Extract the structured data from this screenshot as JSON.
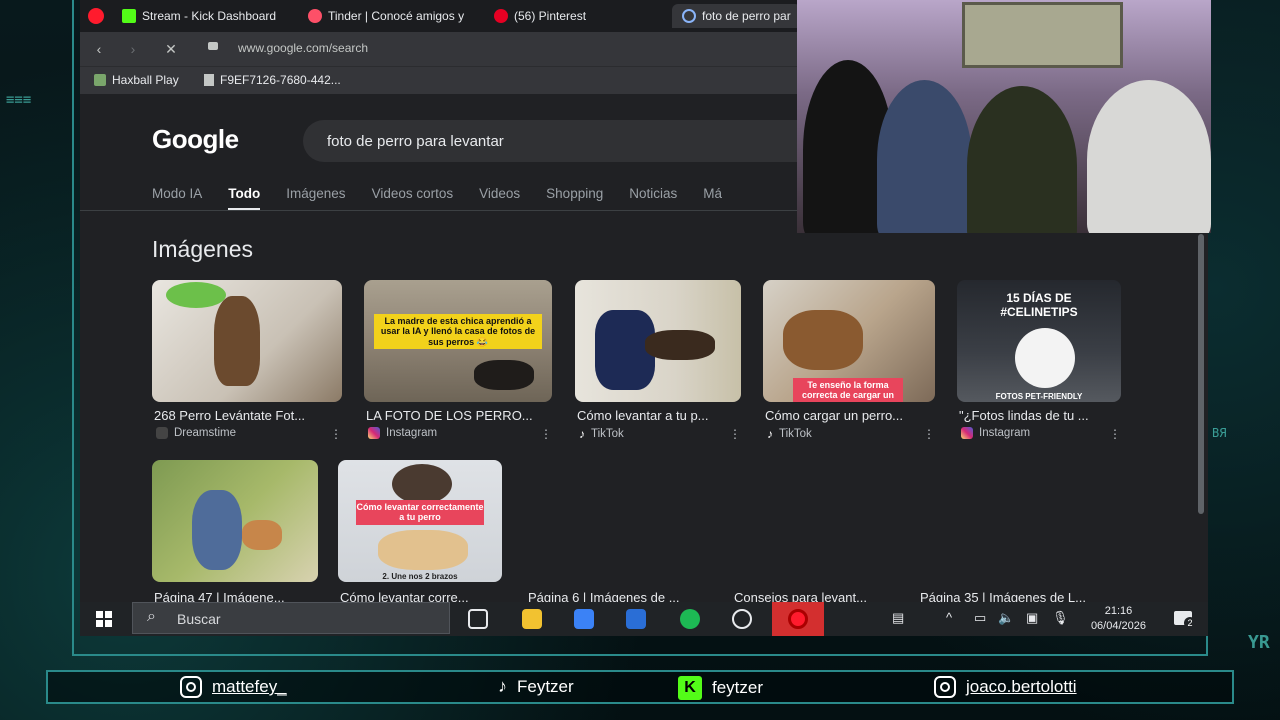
{
  "browser": {
    "tabs": [
      {
        "label": "Stream - Kick Dashboard",
        "color": "#53fc18"
      },
      {
        "label": "Tinder | Conocé amigos y",
        "color": "#fd5068"
      },
      {
        "label": "(56) Pinterest",
        "color": "#e60023"
      },
      {
        "label": "foto de perro par",
        "color": "#8ab4f8"
      }
    ],
    "url": "www.google.com/search",
    "bookmarks": [
      "Haxball Play",
      "F9EF7126-7680-442..."
    ]
  },
  "google": {
    "logo": "Google",
    "query": "foto de perro para levantar",
    "tabs": [
      "Modo IA",
      "Todo",
      "Imágenes",
      "Videos cortos",
      "Videos",
      "Shopping",
      "Noticias",
      "Má"
    ],
    "selected_tab": "Todo",
    "images_heading": "Imágenes",
    "results": [
      {
        "title": "268 Perro Levántate Fot...",
        "source": "Dreamstime",
        "source_color": "#bdc1c6"
      },
      {
        "title": "LA FOTO DE LOS PERRO...",
        "source": "Instagram",
        "source_color": "#d6249f",
        "caption": "La madre de esta chica aprendió a usar la IA y llenó la casa de fotos de sus perros 😂"
      },
      {
        "title": "Cómo levantar a tu p...",
        "source": "TikTok",
        "source_color": "#ffffff"
      },
      {
        "title": "Cómo cargar un perro...",
        "source": "TikTok",
        "source_color": "#ffffff",
        "caption": "Te enseño la forma correcta de cargar un"
      },
      {
        "title": "\"¿Fotos lindas de tu ...",
        "source": "Instagram",
        "source_color": "#d6249f",
        "caption": "15 DÍAS DE #CELINETIPS",
        "caption2": "FOTOS PET-FRIENDLY"
      },
      {
        "title": "Página 47 | Imágene...",
        "source": ""
      },
      {
        "title": "Cómo levantar corre...",
        "source": "",
        "caption": "Cómo levantar correctamente a tu perro",
        "caption2": "2. Une nos 2 brazos"
      },
      {
        "title": "Página 6 | Imágenes de ...",
        "source": ""
      },
      {
        "title": "Consejos para levant...",
        "source": ""
      },
      {
        "title": "Página 35 | Imágenes de L...",
        "source": ""
      }
    ]
  },
  "taskbar": {
    "search_placeholder": "Buscar",
    "time": "21:16",
    "date": "06/04/2026",
    "notifications": "2"
  },
  "socials": [
    {
      "platform": "instagram",
      "handle": "mattefey_"
    },
    {
      "platform": "tiktok",
      "handle": "Feytzer"
    },
    {
      "platform": "kick",
      "handle": "feytzer"
    },
    {
      "platform": "instagram",
      "handle": "joaco.bertolotti"
    }
  ],
  "overlay_text": {
    "left_deco": "≡≡≡",
    "right_deco": "YR",
    "right_mini": "ВЯ"
  }
}
